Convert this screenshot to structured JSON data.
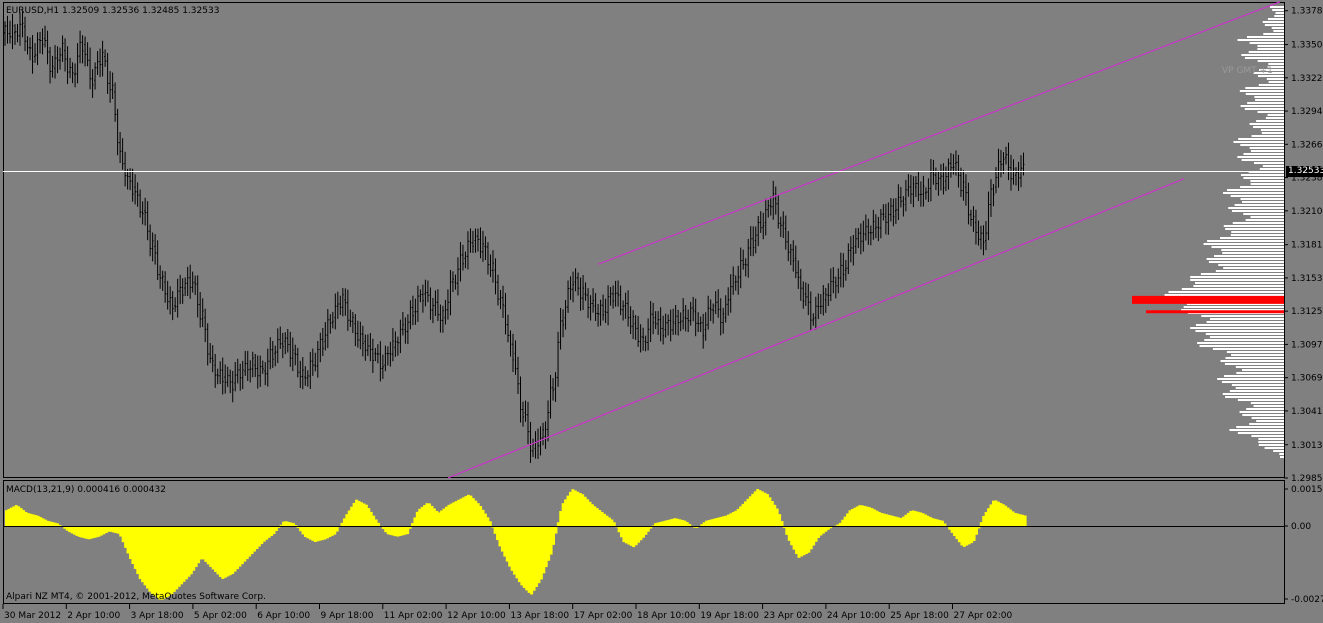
{
  "chart_data": [
    {
      "type": "candlestick",
      "symbol_header": "EURUSD,H1  1.32509 1.32536 1.32485 1.32533",
      "price_ticks": [
        "1.33785",
        "1.33500",
        "1.33220",
        "1.32940",
        "1.32660",
        "1.32380",
        "1.32100",
        "1.31815",
        "1.31535",
        "1.31255",
        "1.30975",
        "1.30695",
        "1.30415",
        "1.30130",
        "1.29850"
      ],
      "current_price": "1.32533",
      "ylim": [
        1.2985,
        1.3385
      ],
      "grid": false,
      "approx_closes": [
        1.336,
        1.3365,
        1.334,
        1.3355,
        1.333,
        1.3345,
        1.3325,
        1.335,
        1.332,
        1.334,
        1.331,
        1.325,
        1.323,
        1.321,
        1.318,
        1.315,
        1.313,
        1.3145,
        1.315,
        1.312,
        1.308,
        1.307,
        1.3065,
        1.3075,
        1.308,
        1.3075,
        1.309,
        1.31,
        1.309,
        1.307,
        1.308,
        1.31,
        1.312,
        1.3135,
        1.3115,
        1.31,
        1.309,
        1.308,
        1.3095,
        1.311,
        1.3125,
        1.314,
        1.313,
        1.312,
        1.315,
        1.317,
        1.3185,
        1.318,
        1.316,
        1.313,
        1.309,
        1.304,
        1.301,
        1.302,
        1.306,
        1.312,
        1.315,
        1.314,
        1.313,
        1.3125,
        1.314,
        1.313,
        1.3115,
        1.31,
        1.312,
        1.311,
        1.3115,
        1.312,
        1.3125,
        1.311,
        1.313,
        1.312,
        1.315,
        1.3165,
        1.3185,
        1.32,
        1.322,
        1.3195,
        1.317,
        1.314,
        1.312,
        1.3135,
        1.315,
        1.316,
        1.318,
        1.319,
        1.3195,
        1.3205,
        1.321,
        1.322,
        1.323,
        1.3225,
        1.324,
        1.3235,
        1.325,
        1.323,
        1.32,
        1.3185,
        1.323,
        1.3255,
        1.324,
        1.3245
      ],
      "channel": {
        "upper": [
          1.3165,
          1.3386
        ],
        "lower": [
          1.2985,
          1.3237
        ],
        "color": "#CC33CC"
      },
      "volume_profile": {
        "label": "VP GMT +1",
        "poc_price": 1.3135,
        "second_price": 1.3125
      }
    },
    {
      "type": "area",
      "title": "MACD(13,21,9) 0.000416 0.000432",
      "ticks": [
        "0.00155",
        "0.00",
        "-0.0027"
      ],
      "ylim": [
        -0.0029,
        0.0017
      ],
      "color": "#FFFF00",
      "values": [
        0.0006,
        0.0008,
        0.0005,
        0.0004,
        0.0002,
        0.0001,
        -0.0002,
        -0.0004,
        -0.0005,
        -0.0004,
        -0.0002,
        -0.0003,
        -0.0012,
        -0.002,
        -0.0025,
        -0.0028,
        -0.0026,
        -0.0022,
        -0.0018,
        -0.0012,
        -0.0016,
        -0.002,
        -0.0018,
        -0.0014,
        -0.001,
        -0.0006,
        -0.0003,
        0.0002,
        0.0001,
        -0.0004,
        -0.0006,
        -0.0005,
        -0.0003,
        0.0004,
        0.001,
        0.0008,
        0.0002,
        -0.0003,
        -0.0004,
        -0.0003,
        0.0006,
        0.0009,
        0.0005,
        0.0008,
        0.001,
        0.0012,
        0.0008,
        0.0002,
        -0.0008,
        -0.0016,
        -0.0022,
        -0.0026,
        -0.002,
        -0.001,
        0.0008,
        0.0014,
        0.0012,
        0.0008,
        0.0005,
        0.0002,
        -0.0006,
        -0.0008,
        -0.0004,
        0.0001,
        0.0002,
        0.0003,
        0.0002,
        -0.0001,
        0.0002,
        0.0003,
        0.0004,
        0.0006,
        0.001,
        0.0014,
        0.0012,
        0.0006,
        -0.0005,
        -0.0012,
        -0.001,
        -0.0004,
        -0.0001,
        0.0001,
        0.0006,
        0.0008,
        0.0007,
        0.0005,
        0.0004,
        0.0003,
        0.0006,
        0.0005,
        0.0003,
        0.0002,
        -0.0003,
        -0.0008,
        -0.0006,
        0.0004,
        0.001,
        0.0008,
        0.0005,
        0.0004
      ]
    }
  ],
  "time_axis": [
    "30 Mar 2012",
    "2 Apr 10:00",
    "3 Apr 18:00",
    "5 Apr 02:00",
    "6 Apr 10:00",
    "9 Apr 18:00",
    "11 Apr 02:00",
    "12 Apr 10:00",
    "13 Apr 18:00",
    "17 Apr 02:00",
    "18 Apr 10:00",
    "19 Apr 18:00",
    "23 Apr 02:00",
    "24 Apr 10:00",
    "25 Apr 18:00",
    "27 Apr 02:00"
  ],
  "copyright": "Alpari NZ MT4, © 2001-2012, MetaQuotes Software Corp.",
  "colors": {
    "background": "#808080",
    "candles": "#000000",
    "price_line": "#FFFFFF",
    "channel": "#CC33CC",
    "volume_profile": "#FFFFFF",
    "poc": "#FF0000",
    "macd": "#FFFF00"
  }
}
